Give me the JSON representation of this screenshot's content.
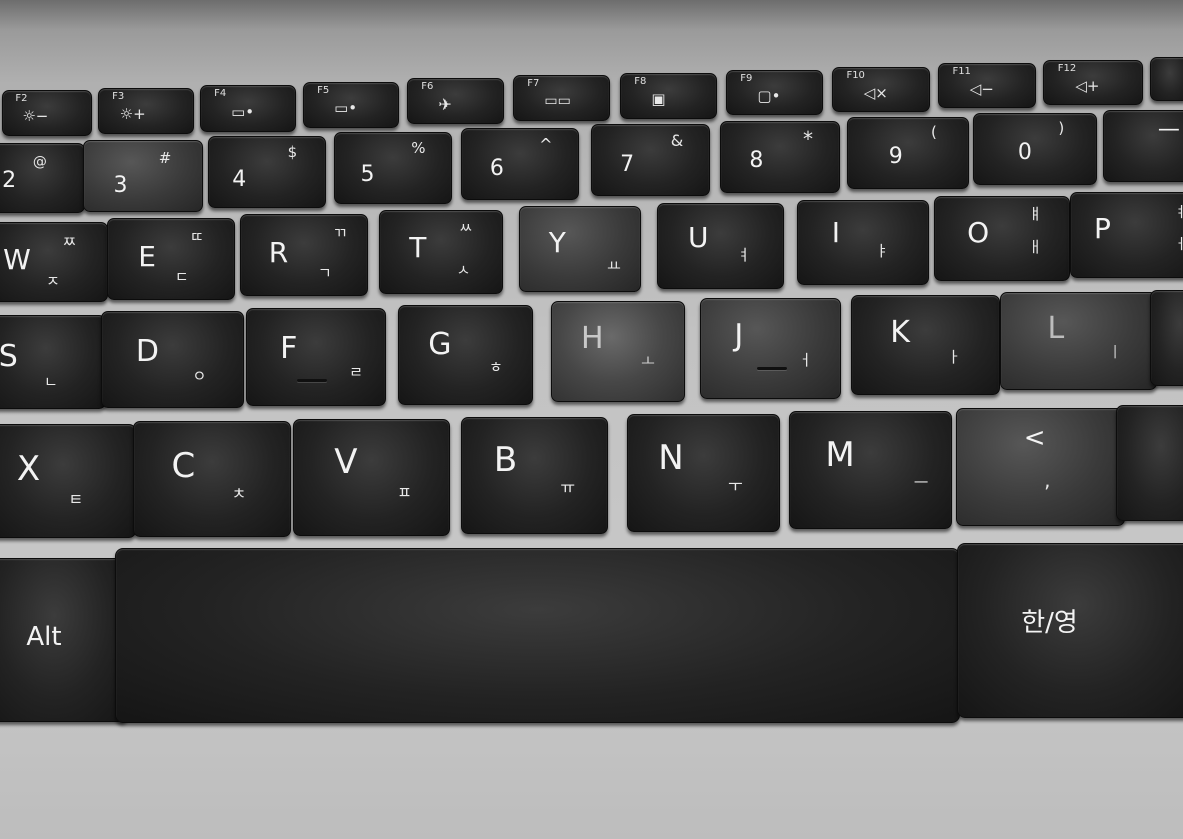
{
  "keyboard": {
    "fn_row": [
      {
        "label": "F2",
        "icon": "☼−",
        "icon_name": "brightness-down-icon"
      },
      {
        "label": "F3",
        "icon": "☼+",
        "icon_name": "brightness-up-icon"
      },
      {
        "label": "F4",
        "icon": "▭",
        "icon_name": "display-switch-icon"
      },
      {
        "label": "F5",
        "icon": "▭•",
        "icon_name": "touchpad-icon"
      },
      {
        "label": "F6",
        "icon": "✈",
        "icon_name": "airplane-mode-icon"
      },
      {
        "label": "F7",
        "icon": "▭▭",
        "icon_name": "screen-extend-icon"
      },
      {
        "label": "F8",
        "icon": "▣",
        "icon_name": "webcam-icon"
      },
      {
        "label": "F9",
        "icon": "▢•",
        "icon_name": "reader-mode-icon"
      },
      {
        "label": "F10",
        "icon": "◁×",
        "icon_name": "mute-icon"
      },
      {
        "label": "F11",
        "icon": "◁−",
        "icon_name": "volume-down-icon"
      },
      {
        "label": "F12",
        "icon": "◁+",
        "icon_name": "volume-up-icon"
      }
    ],
    "number_row": [
      {
        "main": "2",
        "shift": "@"
      },
      {
        "main": "3",
        "shift": "#"
      },
      {
        "main": "4",
        "shift": "$"
      },
      {
        "main": "5",
        "shift": "%"
      },
      {
        "main": "6",
        "shift": "^"
      },
      {
        "main": "7",
        "shift": "&"
      },
      {
        "main": "8",
        "shift": "*"
      },
      {
        "main": "9",
        "shift": "("
      },
      {
        "main": "0",
        "shift": ")"
      },
      {
        "main": "—",
        "shift": ""
      }
    ],
    "top_row": [
      {
        "main": "W",
        "sub": "ㅈ",
        "shift": "ㅉ"
      },
      {
        "main": "E",
        "sub": "ㄷ",
        "shift": "ㄸ"
      },
      {
        "main": "R",
        "sub": "ㄱ",
        "shift": "ㄲ"
      },
      {
        "main": "T",
        "sub": "ㅅ",
        "shift": "ㅆ"
      },
      {
        "main": "Y",
        "sub": "ㅛ",
        "shift": ""
      },
      {
        "main": "U",
        "sub": "ㅕ",
        "shift": ""
      },
      {
        "main": "I",
        "sub": "ㅑ",
        "shift": ""
      },
      {
        "main": "O",
        "sub": "ㅐ",
        "shift": "ㅒ"
      },
      {
        "main": "P",
        "sub": "ㅔ",
        "shift": "ㅖ"
      }
    ],
    "home_row": [
      {
        "main": "S",
        "sub": "ㄴ"
      },
      {
        "main": "D",
        "sub": "ㅇ"
      },
      {
        "main": "F",
        "sub": "ㄹ"
      },
      {
        "main": "G",
        "sub": "ㅎ"
      },
      {
        "main": "H",
        "sub": "ㅗ"
      },
      {
        "main": "J",
        "sub": "ㅓ"
      },
      {
        "main": "K",
        "sub": "ㅏ"
      },
      {
        "main": "L",
        "sub": "ㅣ"
      },
      {
        "main": "",
        "sub": ""
      }
    ],
    "bottom_row": [
      {
        "main": "X",
        "sub": "ㅌ"
      },
      {
        "main": "C",
        "sub": "ㅊ"
      },
      {
        "main": "V",
        "sub": "ㅍ"
      },
      {
        "main": "B",
        "sub": "ㅠ"
      },
      {
        "main": "N",
        "sub": "ㅜ"
      },
      {
        "main": "M",
        "sub": "ㅡ"
      },
      {
        "main": "<",
        "sub": ","
      },
      {
        "main": "",
        "sub": ""
      }
    ],
    "space_row": {
      "alt": "Alt",
      "space": "",
      "hangul": "한/영"
    }
  }
}
